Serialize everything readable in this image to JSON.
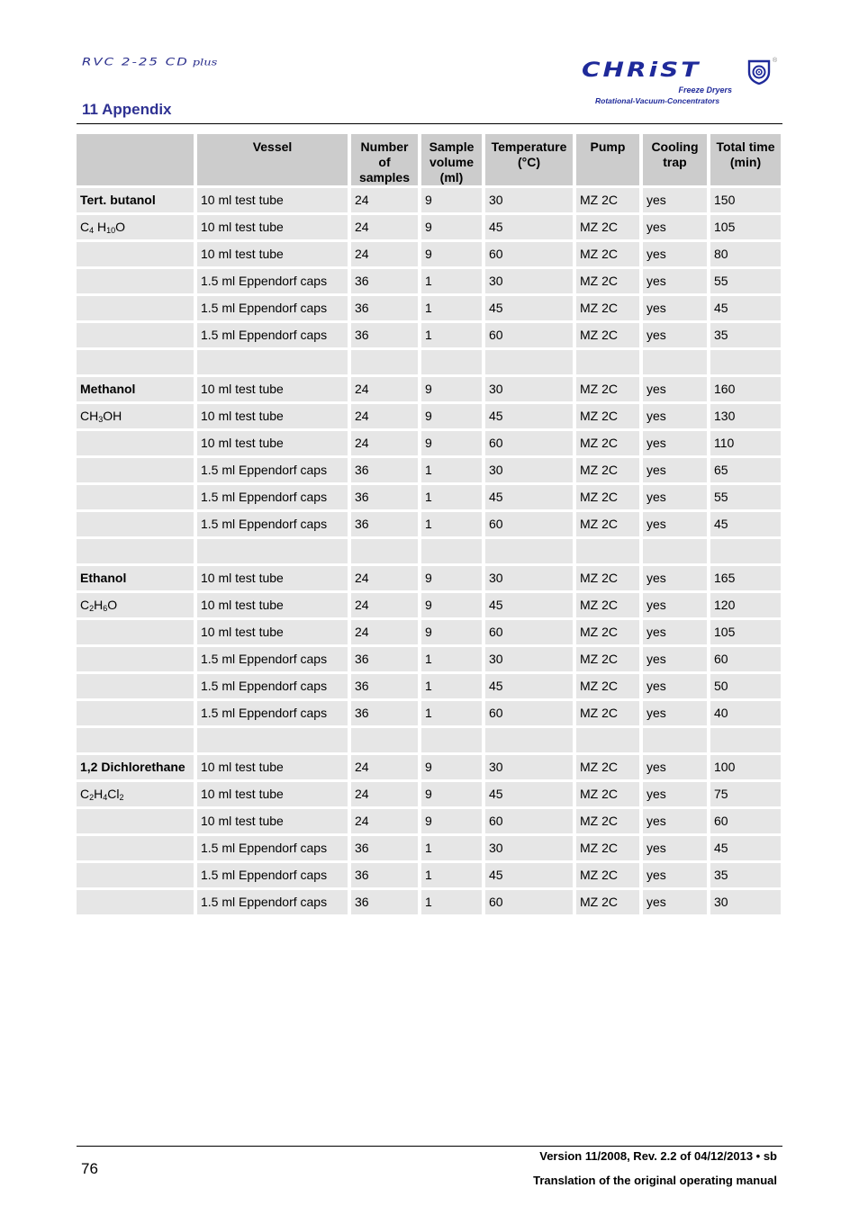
{
  "header": {
    "model": "RVC 2-25 CD",
    "model_suffix": "plus",
    "section_title": "11 Appendix",
    "logo": {
      "wordmark": "CHRiST",
      "line1": "Freeze Dryers",
      "line2": "Rotational-Vacuum-Concentrators",
      "registered": "®",
      "brand_color": "#1f2a9a"
    }
  },
  "table": {
    "columns": [
      "",
      "Vessel",
      "Number of samples",
      "Sample volume (ml)",
      "Temperature (°C)",
      "Pump",
      "Cooling trap",
      "Total time (min)"
    ],
    "column_lines": [
      [
        ""
      ],
      [
        "Vessel"
      ],
      [
        "Number",
        "of",
        "samples"
      ],
      [
        "Sample",
        "volume",
        "(ml)"
      ],
      [
        "Temperature",
        "(°C)"
      ],
      [
        "Pump"
      ],
      [
        "Cooling",
        "trap"
      ],
      [
        "Total time",
        "(min)"
      ]
    ],
    "groups": [
      {
        "name": "Tert. butanol",
        "formula_parts": [
          [
            "C",
            ""
          ],
          [
            "4",
            "sub"
          ],
          [
            " H",
            ""
          ],
          [
            "10",
            "sub"
          ],
          [
            "O",
            ""
          ]
        ],
        "formula": "C4 H10O",
        "rows": [
          [
            "10 ml test tube",
            "24",
            "9",
            "30",
            "MZ 2C",
            "yes",
            "150"
          ],
          [
            "10 ml test tube",
            "24",
            "9",
            "45",
            "MZ 2C",
            "yes",
            "105"
          ],
          [
            "10 ml test tube",
            "24",
            "9",
            "60",
            "MZ 2C",
            "yes",
            "80"
          ],
          [
            "1.5 ml Eppendorf caps",
            "36",
            "1",
            "30",
            "MZ 2C",
            "yes",
            "55"
          ],
          [
            "1.5 ml Eppendorf caps",
            "36",
            "1",
            "45",
            "MZ 2C",
            "yes",
            "45"
          ],
          [
            "1.5 ml Eppendorf caps",
            "36",
            "1",
            "60",
            "MZ 2C",
            "yes",
            "35"
          ]
        ]
      },
      {
        "name": "Methanol",
        "formula_parts": [
          [
            "CH",
            ""
          ],
          [
            "3",
            "sub"
          ],
          [
            "OH",
            ""
          ]
        ],
        "formula": "CH3OH",
        "rows": [
          [
            "10 ml test tube",
            "24",
            "9",
            "30",
            "MZ 2C",
            "yes",
            "160"
          ],
          [
            "10 ml test tube",
            "24",
            "9",
            "45",
            "MZ 2C",
            "yes",
            "130"
          ],
          [
            "10 ml test tube",
            "24",
            "9",
            "60",
            "MZ 2C",
            "yes",
            "110"
          ],
          [
            "1.5 ml Eppendorf caps",
            "36",
            "1",
            "30",
            "MZ 2C",
            "yes",
            "65"
          ],
          [
            "1.5 ml Eppendorf caps",
            "36",
            "1",
            "45",
            "MZ 2C",
            "yes",
            "55"
          ],
          [
            "1.5 ml Eppendorf caps",
            "36",
            "1",
            "60",
            "MZ 2C",
            "yes",
            "45"
          ]
        ]
      },
      {
        "name": "Ethanol",
        "formula_parts": [
          [
            "C",
            ""
          ],
          [
            "2",
            "sub"
          ],
          [
            "H",
            ""
          ],
          [
            "6",
            "sub"
          ],
          [
            "O",
            ""
          ]
        ],
        "formula": "C2H6O",
        "rows": [
          [
            "10 ml test tube",
            "24",
            "9",
            "30",
            "MZ 2C",
            "yes",
            "165"
          ],
          [
            "10 ml test tube",
            "24",
            "9",
            "45",
            "MZ 2C",
            "yes",
            "120"
          ],
          [
            "10 ml test tube",
            "24",
            "9",
            "60",
            "MZ 2C",
            "yes",
            "105"
          ],
          [
            "1.5 ml Eppendorf caps",
            "36",
            "1",
            "30",
            "MZ 2C",
            "yes",
            "60"
          ],
          [
            "1.5 ml Eppendorf caps",
            "36",
            "1",
            "45",
            "MZ 2C",
            "yes",
            "50"
          ],
          [
            "1.5 ml Eppendorf caps",
            "36",
            "1",
            "60",
            "MZ 2C",
            "yes",
            "40"
          ]
        ]
      },
      {
        "name": "1,2 Dichlorethane",
        "formula_parts": [
          [
            "C",
            ""
          ],
          [
            "2",
            "sub"
          ],
          [
            "H",
            ""
          ],
          [
            "4",
            "sub"
          ],
          [
            "Cl",
            ""
          ],
          [
            "2",
            "sub"
          ]
        ],
        "formula": "C2H4Cl2",
        "rows": [
          [
            "10 ml test tube",
            "24",
            "9",
            "30",
            "MZ 2C",
            "yes",
            "100"
          ],
          [
            "10 ml test tube",
            "24",
            "9",
            "45",
            "MZ 2C",
            "yes",
            "75"
          ],
          [
            "10 ml test tube",
            "24",
            "9",
            "60",
            "MZ 2C",
            "yes",
            "60"
          ],
          [
            "1.5 ml Eppendorf caps",
            "36",
            "1",
            "30",
            "MZ 2C",
            "yes",
            "45"
          ],
          [
            "1.5 ml Eppendorf caps",
            "36",
            "1",
            "45",
            "MZ 2C",
            "yes",
            "35"
          ],
          [
            "1.5 ml Eppendorf caps",
            "36",
            "1",
            "60",
            "MZ 2C",
            "yes",
            "30"
          ]
        ]
      }
    ],
    "colors": {
      "header_bg": "#cccccc",
      "cell_bg": "#e6e6e6"
    }
  },
  "footer": {
    "page_number": "76",
    "version": "Version 11/2008, Rev. 2.2 of 04/12/2013 • sb",
    "note": "Translation of the original operating manual"
  }
}
